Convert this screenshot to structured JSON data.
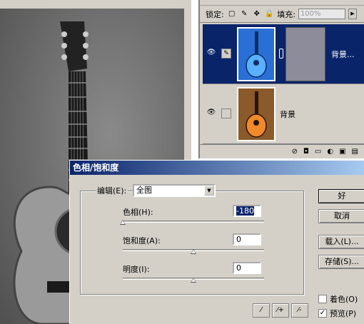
{
  "layers": {
    "lock_label": "锁定:",
    "fill_label": "填充:",
    "fill_value": "100%",
    "items": [
      {
        "name": "背景...",
        "selected": true,
        "thumb_color": "#2a6fd6"
      },
      {
        "name": "背景",
        "selected": false,
        "thumb_color": "#d96b1a"
      }
    ]
  },
  "dialog": {
    "title": "色相/饱和度",
    "edit_label": "编辑(E):",
    "edit_value": "全图",
    "hue": {
      "label": "色相(H):",
      "value": "-180",
      "level": 0
    },
    "saturation": {
      "label": "饱和度(A):",
      "value": "0",
      "level": 0.5
    },
    "lightness": {
      "label": "明度(I):",
      "value": "0",
      "level": 0.5
    },
    "buttons": {
      "ok": "好",
      "cancel": "取消",
      "load": "载入(L)...",
      "save": "存储(S)..."
    },
    "colorize": {
      "label": "着色(O)",
      "checked": false
    },
    "preview": {
      "label": "预览(P)",
      "checked": true
    }
  }
}
